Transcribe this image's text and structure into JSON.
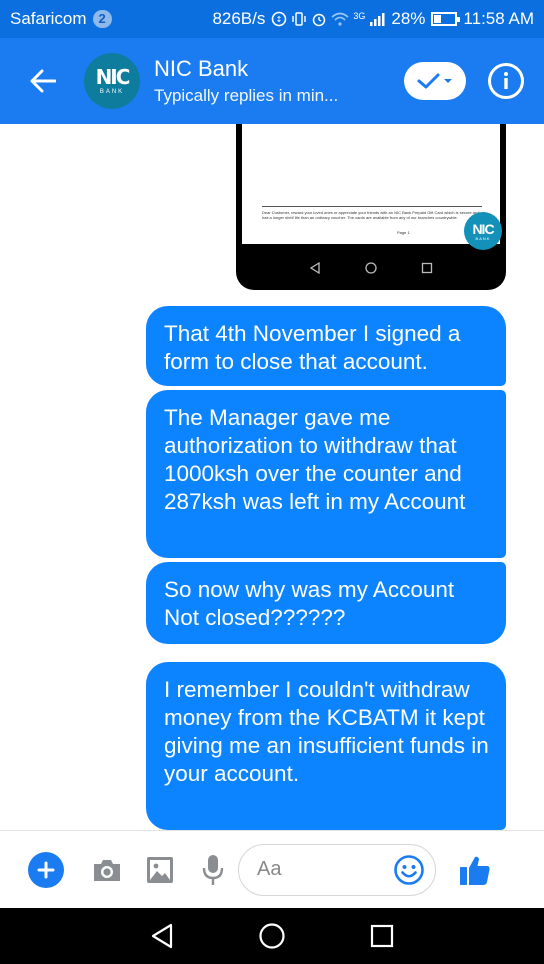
{
  "status_bar": {
    "carrier": "Safaricom",
    "notification_count": "2",
    "speed": "826B/s",
    "network": "3G",
    "battery": "28%",
    "battery_level": 0.28,
    "time": "11:58 AM"
  },
  "header": {
    "contact_name": "NIC Bank",
    "contact_status": "Typically replies in min...",
    "avatar_logo": "NIC",
    "avatar_sub": "BANK"
  },
  "shared_image": {
    "doc_text": "Dear Customer, reward your loved ones or appreciate your friends with an NIC Bank Prepaid Gift Card which is secure and has a longer shelf life than an ordinary voucher. The cards are available from any of our branches countrywide.",
    "page_label": "Page 1",
    "logo_text": "NIC",
    "logo_sub": "BANK"
  },
  "messages": [
    {
      "text": "That 4th November I signed a form to close that account."
    },
    {
      "text": "The Manager gave me authorization to withdraw that 1000ksh over the counter and 287ksh was left in my Account"
    },
    {
      "text": "So now why was my Account Not closed??????"
    },
    {
      "text": "I remember I couldn't withdraw money from the KCBATM it kept giving me an insufficient funds in your account."
    }
  ],
  "composer": {
    "placeholder": "Aa"
  },
  "colors": {
    "status_bar": "#0c6fe0",
    "header": "#1a7cf0",
    "bubble": "#0d84ff",
    "accent": "#1a7cf0",
    "nav_bar": "#000000"
  },
  "icons": {
    "back": "arrow-left-icon",
    "check": "check-dropdown-icon",
    "info": "info-icon",
    "plus": "plus-icon",
    "camera": "camera-icon",
    "gallery": "image-icon",
    "mic": "microphone-icon",
    "emoji": "smiley-icon",
    "like": "thumbs-up-icon",
    "nav_back": "triangle-back-icon",
    "nav_home": "circle-home-icon",
    "nav_recents": "square-recents-icon"
  }
}
